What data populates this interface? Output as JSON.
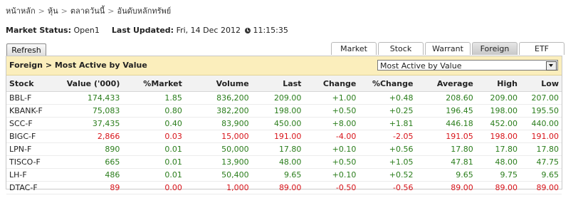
{
  "breadcrumb": {
    "items": [
      "หน้าหลัก",
      "หุ้น",
      "ตลาดวันนี้",
      "อันดับหลักทรัพย์"
    ],
    "separator": ">"
  },
  "status": {
    "market_label": "Market Status:",
    "market_value": "Open1",
    "updated_label": "Last Updated:",
    "updated_date": "Fri, 14 Dec 2012",
    "updated_time": "11:15:35"
  },
  "refresh_label": "Refresh",
  "tabs": [
    {
      "label": "Market",
      "active": false
    },
    {
      "label": "Stock",
      "active": false
    },
    {
      "label": "Warrant",
      "active": false
    },
    {
      "label": "Foreign",
      "active": true
    },
    {
      "label": "ETF",
      "active": false
    }
  ],
  "panel": {
    "title": "Foreign > Most Active by Value",
    "select_value": "Most Active by Value"
  },
  "colors": {
    "up": "#2a7d1b",
    "down": "#d8141a",
    "header_bg": "#fbeebc"
  },
  "table": {
    "headers": [
      "Stock",
      "Value ('000)",
      "%Market",
      "Volume",
      "Last",
      "Change",
      "%Change",
      "Average",
      "High",
      "Low"
    ],
    "rows": [
      {
        "dir": "up",
        "cells": [
          "BBL-F",
          "174,433",
          "1.85",
          "836,200",
          "209.00",
          "+1.00",
          "+0.48",
          "208.60",
          "209.00",
          "207.00"
        ]
      },
      {
        "dir": "up",
        "cells": [
          "KBANK-F",
          "75,083",
          "0.80",
          "382,200",
          "198.00",
          "+0.50",
          "+0.25",
          "196.45",
          "198.00",
          "195.50"
        ]
      },
      {
        "dir": "up",
        "cells": [
          "SCC-F",
          "37,435",
          "0.40",
          "83,900",
          "450.00",
          "+8.00",
          "+1.81",
          "446.18",
          "452.00",
          "440.00"
        ]
      },
      {
        "dir": "dn",
        "cells": [
          "BIGC-F",
          "2,866",
          "0.03",
          "15,000",
          "191.00",
          "-4.00",
          "-2.05",
          "191.05",
          "198.00",
          "191.00"
        ]
      },
      {
        "dir": "up",
        "cells": [
          "LPN-F",
          "890",
          "0.01",
          "50,000",
          "17.80",
          "+0.10",
          "+0.56",
          "17.80",
          "17.80",
          "17.80"
        ]
      },
      {
        "dir": "up",
        "cells": [
          "TISCO-F",
          "665",
          "0.01",
          "13,900",
          "48.00",
          "+0.50",
          "+1.05",
          "47.81",
          "48.00",
          "47.75"
        ]
      },
      {
        "dir": "up",
        "cells": [
          "LH-F",
          "486",
          "0.01",
          "50,400",
          "9.65",
          "+0.10",
          "+0.52",
          "9.65",
          "9.75",
          "9.65"
        ]
      },
      {
        "dir": "dn",
        "cells": [
          "DTAC-F",
          "89",
          "0.00",
          "1,000",
          "89.00",
          "-0.50",
          "-0.56",
          "89.00",
          "89.00",
          "89.00"
        ]
      }
    ]
  }
}
